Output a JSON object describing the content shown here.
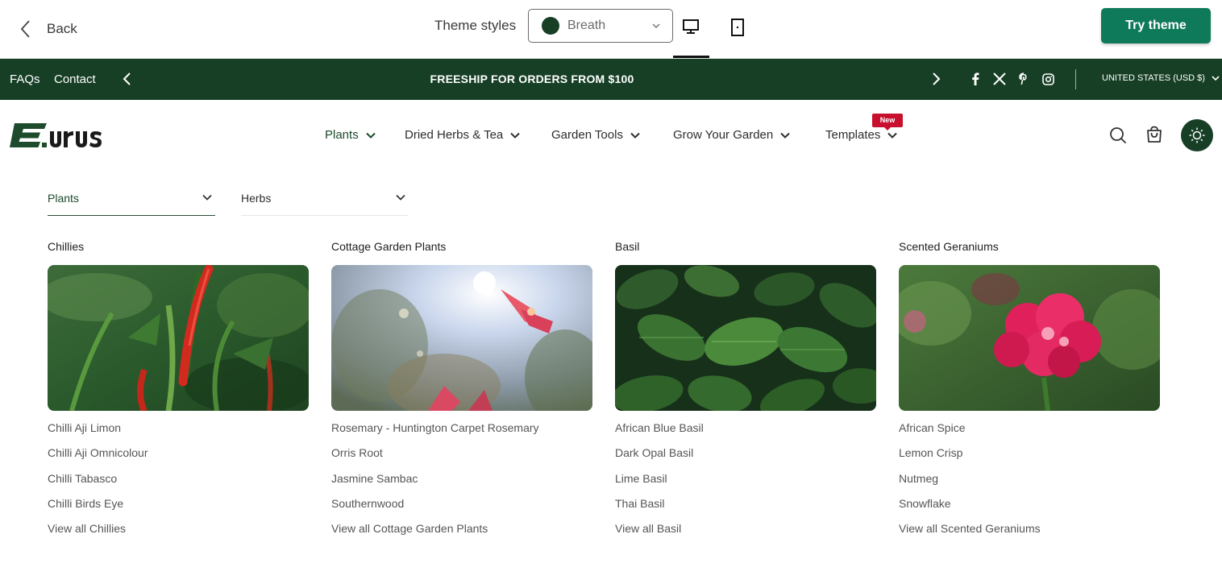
{
  "toolbar": {
    "back_label": "Back",
    "theme_styles_label": "Theme styles",
    "theme_style_value": "Breath",
    "theme_style_color": "#173f26",
    "try_theme_label": "Try theme",
    "try_theme_color": "#0f7a5a",
    "device_icons": [
      "desktop-icon",
      "mobile-icon"
    ]
  },
  "announcement": {
    "background": "#173f26",
    "links": [
      "FAQs",
      "Contact"
    ],
    "message": "FREESHIP FOR ORDERS FROM $100",
    "social_icons": [
      "facebook-icon",
      "x-icon",
      "pinterest-icon",
      "instagram-icon"
    ],
    "currency": "UNITED STATES (USD $)"
  },
  "header": {
    "logo_text": "Eurus",
    "nav": [
      {
        "label": "Plants"
      },
      {
        "label": "Dried Herbs & Tea"
      },
      {
        "label": "Garden Tools"
      },
      {
        "label": "Grow Your Garden"
      },
      {
        "label": "Templates",
        "badge": "New"
      }
    ],
    "icons": [
      "search-icon",
      "cart-icon",
      "sun-icon"
    ],
    "accent": "#173f26"
  },
  "mega_menu": {
    "dropdowns": [
      "Plants",
      "Herbs"
    ],
    "columns": [
      {
        "title": "Chillies",
        "image": "chilli-peppers-photo",
        "items": [
          "Chilli Aji Limon",
          "Chilli Aji Omnicolour",
          "Chilli Tabasco",
          "Chilli Birds Eye",
          "View all Chillies"
        ]
      },
      {
        "title": "Cottage Garden Plants",
        "image": "cottage-garden-flowers-photo",
        "items": [
          "Rosemary - Huntington Carpet Rosemary",
          "Orris Root",
          "Jasmine Sambac",
          "Southernwood",
          "View all Cottage Garden Plants"
        ]
      },
      {
        "title": "Basil",
        "image": "basil-leaves-photo",
        "items": [
          "African Blue Basil",
          "Dark Opal Basil",
          "Lime Basil",
          "Thai Basil",
          "View all Basil"
        ]
      },
      {
        "title": "Scented Geraniums",
        "image": "pink-geranium-photo",
        "items": [
          "African Spice",
          "Lemon Crisp",
          "Nutmeg",
          "Snowflake",
          "View all Scented Geraniums"
        ]
      }
    ]
  }
}
